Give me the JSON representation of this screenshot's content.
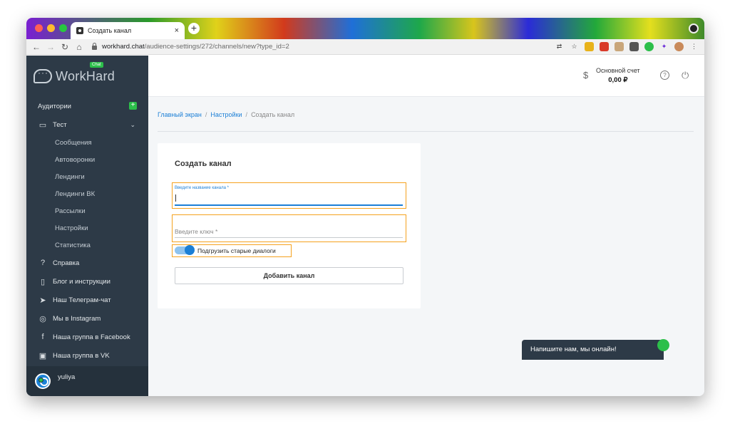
{
  "browser": {
    "tab_title": "Создать канал",
    "tab_close": "×",
    "new_tab": "+",
    "url_host": "workhard.chat",
    "url_path": "/audience-settings/272/channels/new?type_id=2"
  },
  "brand": {
    "name": "WorkHard",
    "badge": "Chat"
  },
  "sidebar": {
    "audiences_label": "Аудитории",
    "add_symbol": "+",
    "group_label": "Тест",
    "sub_items": [
      {
        "label": "Сообщения"
      },
      {
        "label": "Автоворонки"
      },
      {
        "label": "Лендинги"
      },
      {
        "label": "Лендинги ВК"
      },
      {
        "label": "Рассылки"
      },
      {
        "label": "Настройки"
      },
      {
        "label": "Статистика"
      }
    ],
    "links": [
      {
        "label": "Справка",
        "icon": "help-circle-icon"
      },
      {
        "label": "Блог и инструкции",
        "icon": "book-icon"
      },
      {
        "label": "Наш Телеграм-чат",
        "icon": "telegram-icon"
      },
      {
        "label": "Мы в Instagram",
        "icon": "instagram-icon"
      },
      {
        "label": "Наша группа в Facebook",
        "icon": "facebook-icon"
      },
      {
        "label": "Наша группа в VK",
        "icon": "vk-icon"
      }
    ],
    "user": "yuliya"
  },
  "header": {
    "account_label": "Основной счет",
    "account_value": "0,00 ₽",
    "currency_symbol": "$"
  },
  "breadcrumb": {
    "home": "Главный экран",
    "settings": "Настройки",
    "current": "Создать канал",
    "separator": "/"
  },
  "form": {
    "title": "Создать канал",
    "name_label": "Введите название канала *",
    "name_value": "",
    "key_placeholder": "Введите ключ *",
    "toggle_label": "Подгрузить старые диалоги",
    "toggle_on": true,
    "submit_label": "Добавить канал"
  },
  "chat_widget": {
    "text": "Напишите нам, мы онлайн!"
  },
  "colors": {
    "sidebar_bg": "#2d3a47",
    "accent": "#1b7fd6",
    "highlight": "#f5a21e",
    "green": "#2cbf4a"
  }
}
